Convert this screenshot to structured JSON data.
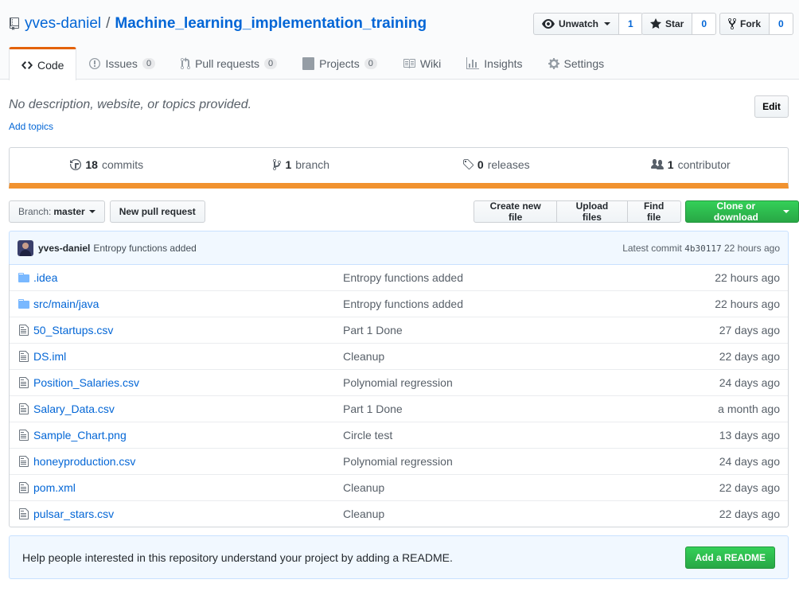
{
  "repo": {
    "owner": "yves-daniel",
    "separator": "/",
    "name": "Machine_learning_implementation_training"
  },
  "social": {
    "watch_label": "Unwatch",
    "watch_count": "1",
    "star_label": "Star",
    "star_count": "0",
    "fork_label": "Fork",
    "fork_count": "0"
  },
  "tabs": [
    {
      "label": "Code",
      "icon": "code-icon",
      "selected": true
    },
    {
      "label": "Issues",
      "icon": "issue-icon",
      "counter": "0"
    },
    {
      "label": "Pull requests",
      "icon": "pull-request-icon",
      "counter": "0"
    },
    {
      "label": "Projects",
      "icon": "project-icon",
      "counter": "0"
    },
    {
      "label": "Wiki",
      "icon": "book-icon"
    },
    {
      "label": "Insights",
      "icon": "graph-icon"
    },
    {
      "label": "Settings",
      "icon": "gear-icon"
    }
  ],
  "description": {
    "text": "No description, website, or topics provided.",
    "add_topics": "Add topics",
    "edit_label": "Edit"
  },
  "summary": {
    "commits_count": "18",
    "commits_label": "commits",
    "branch_count": "1",
    "branch_label": "branch",
    "releases_count": "0",
    "releases_label": "releases",
    "contributor_count": "1",
    "contributor_label": "contributor",
    "language_bar_color": "#f1922f"
  },
  "filenav": {
    "branch_prefix": "Branch:",
    "branch_name": "master",
    "new_pr": "New pull request",
    "create_file": "Create new file",
    "upload_files": "Upload files",
    "find_file": "Find file",
    "clone": "Clone or download"
  },
  "latest_commit": {
    "author": "yves-daniel",
    "message": "Entropy functions added",
    "label": "Latest commit",
    "sha": "4b30117",
    "age": "22 hours ago"
  },
  "files": [
    {
      "name": ".idea",
      "type": "dir",
      "message": "Entropy functions added",
      "age": "22 hours ago"
    },
    {
      "name": "src/main/java",
      "type": "dir",
      "message": "Entropy functions added",
      "age": "22 hours ago"
    },
    {
      "name": "50_Startups.csv",
      "type": "file",
      "message": "Part 1 Done",
      "age": "27 days ago"
    },
    {
      "name": "DS.iml",
      "type": "file",
      "message": "Cleanup",
      "age": "22 days ago"
    },
    {
      "name": "Position_Salaries.csv",
      "type": "file",
      "message": "Polynomial regression",
      "age": "24 days ago"
    },
    {
      "name": "Salary_Data.csv",
      "type": "file",
      "message": "Part 1 Done",
      "age": "a month ago"
    },
    {
      "name": "Sample_Chart.png",
      "type": "file",
      "message": "Circle test",
      "age": "13 days ago"
    },
    {
      "name": "honeyproduction.csv",
      "type": "file",
      "message": "Polynomial regression",
      "age": "24 days ago"
    },
    {
      "name": "pom.xml",
      "type": "file",
      "message": "Cleanup",
      "age": "22 days ago"
    },
    {
      "name": "pulsar_stars.csv",
      "type": "file",
      "message": "Cleanup",
      "age": "22 days ago"
    }
  ],
  "readme_prompt": {
    "text": "Help people interested in this repository understand your project by adding a README.",
    "button": "Add a README"
  }
}
